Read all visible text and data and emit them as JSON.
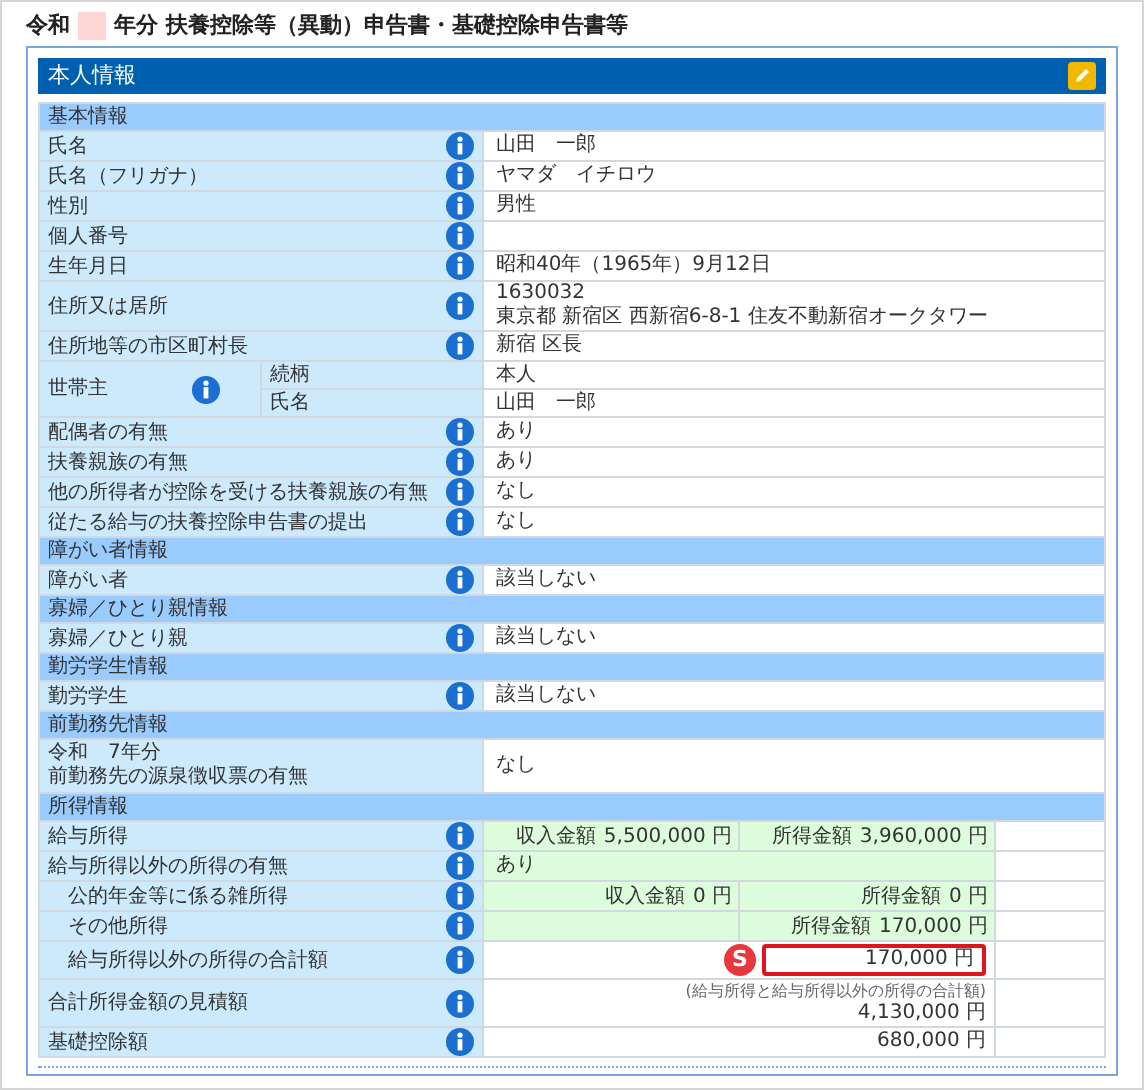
{
  "title": {
    "prefix": "令和",
    "suffix": "年分 扶養控除等（異動）申告書・基礎控除申告書等"
  },
  "panel": {
    "title": "本人情報"
  },
  "sections": [
    {
      "heading": "基本情報",
      "rows": [
        {
          "kind": "text",
          "label": "氏名",
          "info": true,
          "lines": [
            "山田　一郎"
          ]
        },
        {
          "kind": "text",
          "label": "氏名（フリガナ）",
          "info": true,
          "lines": [
            "ヤマダ　イチロウ"
          ]
        },
        {
          "kind": "text",
          "label": "性別",
          "info": true,
          "lines": [
            "男性"
          ]
        },
        {
          "kind": "text",
          "label": "個人番号",
          "info": true
        },
        {
          "kind": "text",
          "label": "生年月日",
          "info": true,
          "lines": [
            "昭和40年（1965年）9月12日"
          ]
        },
        {
          "kind": "text",
          "label": "住所又は居所",
          "info": true,
          "lines": [
            "1630032",
            "東京都 新宿区 西新宿6-8-1 住友不動新宿オークタワー"
          ]
        },
        {
          "kind": "text",
          "label": "住所地等の市区町村長",
          "info": true,
          "lines": [
            "新宿 区長"
          ]
        },
        {
          "kind": "split",
          "label": "世帯主",
          "info": true,
          "subrows": [
            {
              "label": "続柄",
              "value": "本人"
            },
            {
              "label": "氏名",
              "value": "山田　一郎"
            }
          ]
        },
        {
          "kind": "text",
          "label": "配偶者の有無",
          "info": true,
          "lines": [
            "あり"
          ]
        },
        {
          "kind": "text",
          "label": "扶養親族の有無",
          "info": true,
          "lines": [
            "あり"
          ]
        },
        {
          "kind": "text",
          "label": "他の所得者が控除を受ける扶養親族の有無",
          "info": true,
          "lines": [
            "なし"
          ]
        },
        {
          "kind": "text",
          "label": "従たる給与の扶養控除申告書の提出",
          "info": true,
          "lines": [
            "なし"
          ]
        }
      ]
    },
    {
      "heading": "障がい者情報",
      "rows": [
        {
          "kind": "text",
          "label": "障がい者",
          "info": true,
          "lines": [
            "該当しない"
          ]
        }
      ]
    },
    {
      "heading": "寡婦／ひとり親情報",
      "rows": [
        {
          "kind": "text",
          "label": "寡婦／ひとり親",
          "info": true,
          "lines": [
            "該当しない"
          ]
        }
      ]
    },
    {
      "heading": "勤労学生情報",
      "rows": [
        {
          "kind": "text",
          "label": "勤労学生",
          "info": true,
          "lines": [
            "該当しない"
          ]
        }
      ]
    },
    {
      "heading": "前勤務先情報",
      "rows": [
        {
          "kind": "twoline",
          "label_lines": [
            "令和　7年分",
            "前勤務先の源泉徴収票の有無"
          ],
          "info": false,
          "lines": [
            "なし"
          ]
        }
      ]
    },
    {
      "heading": "所得情報",
      "rows": [
        {
          "kind": "amounts",
          "label": "給与所得",
          "info": true,
          "indent": false,
          "revenue": {
            "caption": "収入金額",
            "amount": "5,500,000 円"
          },
          "earned": {
            "caption": "所得金額",
            "amount": "3,960,000 円"
          }
        },
        {
          "kind": "note",
          "label": "給与所得以外の所得の有無",
          "info": true,
          "indent": false,
          "value": "あり"
        },
        {
          "kind": "amounts",
          "label": "公的年金等に係る雑所得",
          "info": true,
          "indent": true,
          "revenue": {
            "caption": "収入金額",
            "amount": "0 円"
          },
          "earned": {
            "caption": "所得金額",
            "amount": "0 円"
          }
        },
        {
          "kind": "amounts",
          "label": "その他所得",
          "info": true,
          "indent": true,
          "earned": {
            "caption": "所得金額",
            "amount": "170,000 円"
          }
        },
        {
          "kind": "total",
          "label": "給与所得以外の所得の合計額",
          "info": true,
          "indent": true,
          "badge": "S",
          "value": "170,000 円"
        },
        {
          "kind": "estimate",
          "label": "合計所得金額の見積額",
          "info": true,
          "indent": false,
          "note": "(給与所得と給与所得以外の所得の合計額)",
          "value": "4,130,000 円"
        },
        {
          "kind": "right",
          "label": "基礎控除額",
          "info": true,
          "indent": false,
          "value": "680,000 円"
        }
      ]
    }
  ]
}
